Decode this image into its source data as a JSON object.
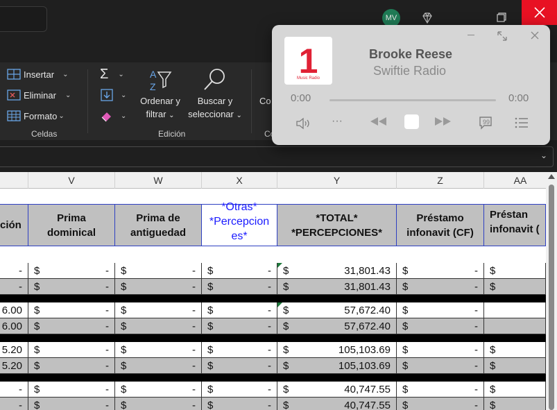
{
  "titlebar": {
    "avatar_initials": "MV"
  },
  "ribbon": {
    "cells": {
      "insert_label": "Insertar",
      "delete_label": "Eliminar",
      "format_label": "Formato",
      "group_label": "Celdas"
    },
    "editing": {
      "sort_filter_label_1": "Ordenar y",
      "sort_filter_label_2": "filtrar",
      "find_select_label_1": "Buscar y",
      "find_select_label_2": "seleccionar",
      "group_label": "Edición"
    },
    "partial_label": "Co",
    "partial_group": "Co"
  },
  "columns": [
    "",
    "V",
    "W",
    "X",
    "Y",
    "Z",
    "AA"
  ],
  "headers": [
    "ción",
    "Prima dominical",
    "Prima de antiguedad",
    "*Otras* *Percepciones*",
    "*TOTAL* *PERCEPCIONES*",
    "Préstamo infonavit (CF)",
    "Préstamo infonavit ("
  ],
  "header_lines": {
    "c0": [
      "ción"
    ],
    "c1": [
      "Prima",
      "dominical"
    ],
    "c2": [
      "Prima de",
      "antiguedad"
    ],
    "c3": [
      "*Otras*",
      "*Percepcion",
      "es*"
    ],
    "c4": [
      "*TOTAL*",
      "*PERCEPCIONES*"
    ],
    "c5": [
      "Préstamo",
      "infonavit (CF)"
    ],
    "c6": [
      "Préstan",
      "infonavit ("
    ]
  },
  "rows": [
    {
      "first": "-",
      "total": "31,801.43",
      "gray": false
    },
    {
      "first": "-",
      "total": "31,801.43",
      "gray": true
    },
    {
      "first": "6.00",
      "total": "57,672.40",
      "gray": false
    },
    {
      "first": "6.00",
      "total": "57,672.40",
      "gray": true
    },
    {
      "first": "5.20",
      "total": "105,103.69",
      "gray": false
    },
    {
      "first": "5.20",
      "total": "105,103.69",
      "gray": true
    },
    {
      "first": "-",
      "total": "40,747.55",
      "gray": false
    },
    {
      "first": "-",
      "total": "40,747.55",
      "gray": true
    }
  ],
  "currency": "$",
  "dash": "-",
  "player": {
    "art_number": "1",
    "art_brand": "Music Radio",
    "title": "Brooke Reese",
    "subtitle": "Swiftie Radio",
    "time_elapsed": "0:00",
    "time_total": "0:00",
    "progress": 0
  },
  "colors": {
    "accent_red": "#e81123",
    "header_blue": "#1a1aff",
    "border_blue": "#2d3fc2",
    "gray_fill": "#c0c0c0"
  }
}
